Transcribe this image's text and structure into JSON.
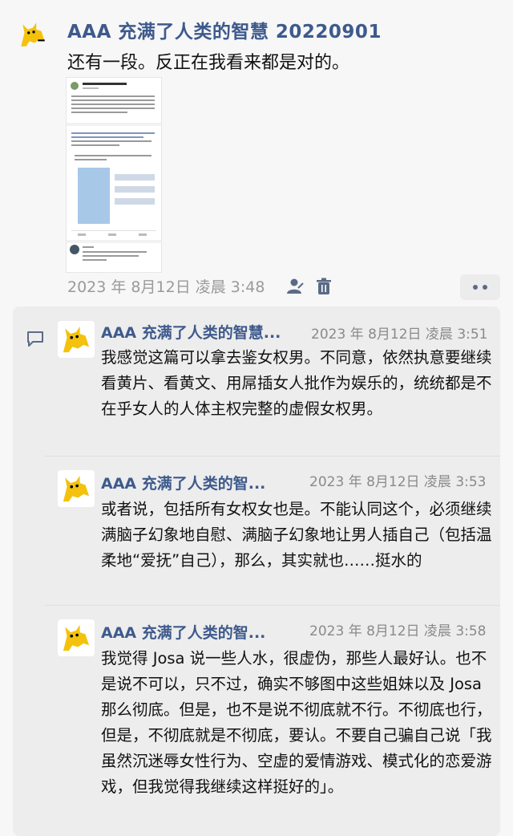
{
  "post": {
    "author": "AAA 充满了人类的智慧 20220901",
    "text": "还有一段。反正在我看来都是对的。",
    "timestamp": "2023 年 8月12日 凌晨 3:48",
    "icons": [
      "person-icon",
      "trash-icon",
      "more-icon",
      "comment-icon"
    ]
  },
  "comments": [
    {
      "author": "AAA 充满了人类的智慧...",
      "time": "2023 年 8月12日 凌晨 3:51",
      "text": "我感觉这篇可以拿去鉴女权男。不同意，依然执意要继续看黄片、看黄文、用屌插女人批作为娱乐的，统统都是不在乎女人的人体主权完整的虚假女权男。"
    },
    {
      "author": "AAA 充满了人类的智...",
      "time": "2023 年 8月12日 凌晨 3:53",
      "text": "或者说，包括所有女权女也是。不能认同这个，必须继续满脑子幻象地自慰、满脑子幻象地让男人插自己（包括温柔地“爱抚”自己），那么，其实就也……挺水的"
    },
    {
      "author": "AAA 充满了人类的智...",
      "time": "2023 年 8月12日 凌晨 3:58",
      "text": "我觉得 Josa 说一些人水，很虚伪，那些人最好认。也不是说不可以，只不过，确实不够图中这些姐妹以及 Josa 那么彻底。但是，也不是说不彻底就不行。不彻底也行，但是，不彻底就是不彻底，要认。不要自己骗自己说「我虽然沉迷辱女性行为、空虚的爱情游戏、模式化的恋爱游戏，但我觉得我继续这样挺好的」。"
    }
  ],
  "colors": {
    "author": "#3e5a8c",
    "meta": "#9a9a9a",
    "panel": "#ededed",
    "icon": "#5b6b86"
  }
}
